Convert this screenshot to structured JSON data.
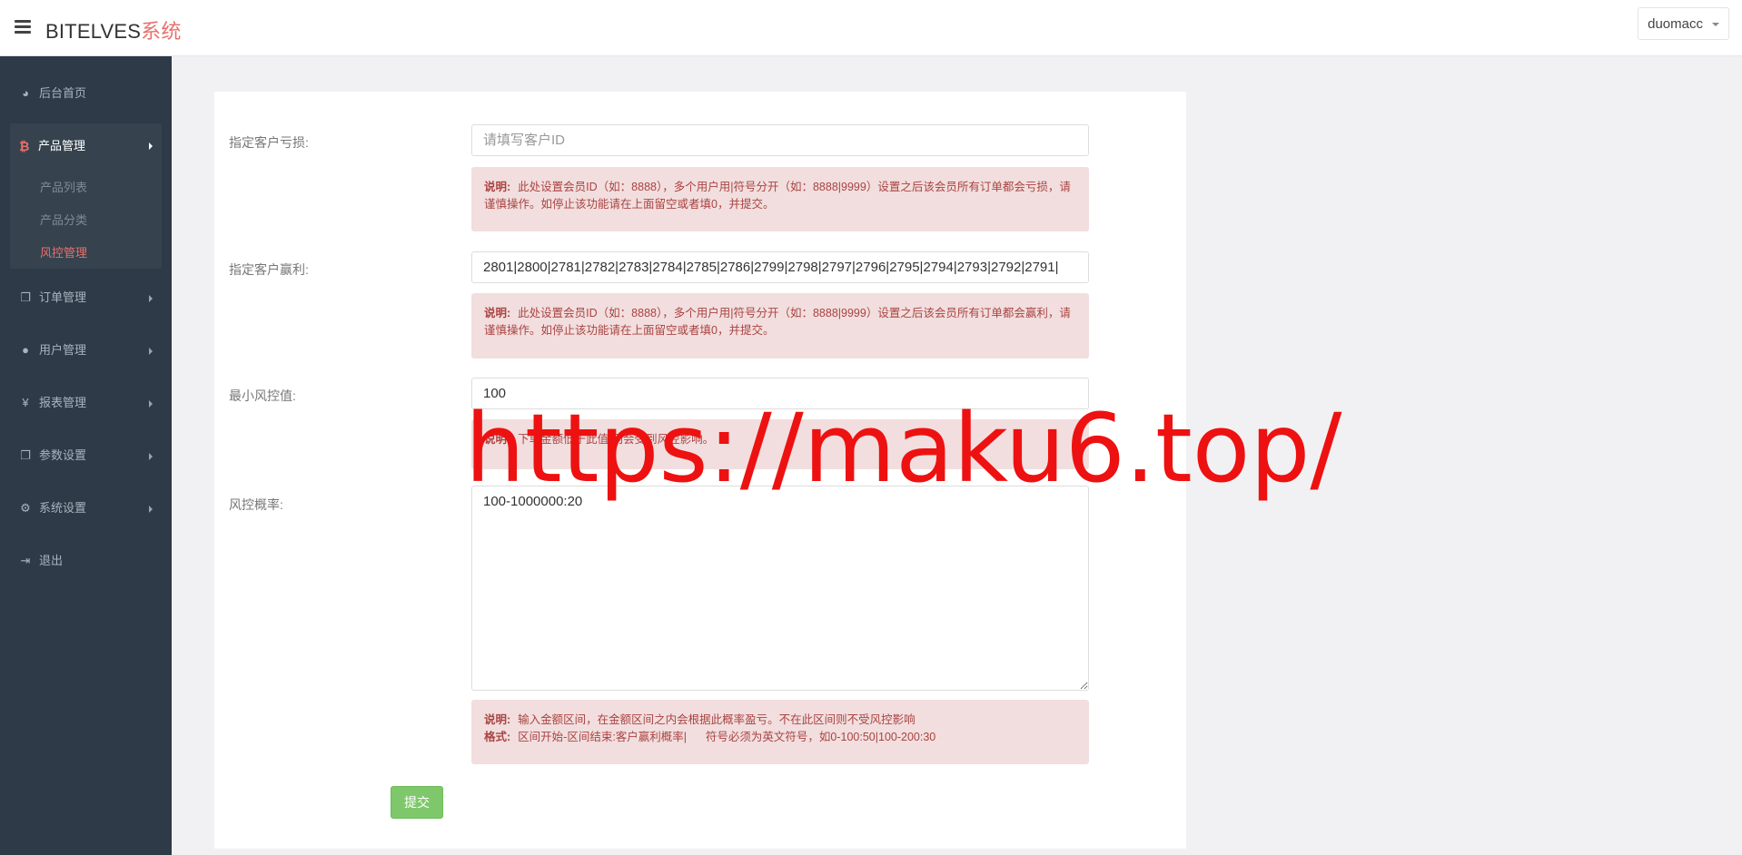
{
  "header": {
    "brand_main": "BITELVES",
    "brand_accent": "系统",
    "user_name": "duomacc"
  },
  "sidebar": {
    "items": [
      {
        "icon": "dashboard-icon",
        "label": "后台首页"
      },
      {
        "icon": "bitcoin-icon",
        "label": "产品管理"
      },
      {
        "icon": "copy-icon",
        "label": "订单管理"
      },
      {
        "icon": "user-icon",
        "label": "用户管理"
      },
      {
        "icon": "yen-icon",
        "label": "报表管理"
      },
      {
        "icon": "copy-icon",
        "label": "参数设置"
      },
      {
        "icon": "gears-icon",
        "label": "系统设置"
      },
      {
        "icon": "sign-out-icon",
        "label": "退出"
      }
    ],
    "sub_items": [
      {
        "label": "产品列表"
      },
      {
        "label": "产品分类"
      },
      {
        "label": "风控管理"
      }
    ],
    "active_color": "#e8706a"
  },
  "form": {
    "loss_label": "指定客户亏损:",
    "loss_placeholder": "请填写客户ID",
    "loss_value": "",
    "loss_note_title": "说明:",
    "loss_note_text": "此处设置会员ID（如：8888），多个用户用|符号分开（如：8888|9999）设置之后该会员所有订单都会亏损，请谨慎操作。如停止该功能请在上面留空或者填0，并提交。",
    "win_label": "指定客户赢利:",
    "win_value": "2801|2800|2781|2782|2783|2784|2785|2786|2799|2798|2797|2796|2795|2794|2793|2792|2791|",
    "win_note_title": "说明:",
    "win_note_text": "此处设置会员ID（如：8888），多个用户用|符号分开（如：8888|9999）设置之后该会员所有订单都会赢利，请谨慎操作。如停止该功能请在上面留空或者填0，并提交。",
    "min_label": "最小风控值:",
    "min_value": "100",
    "min_note_title": "说明:",
    "min_note_text": "下单金额低于此值,则会受到风控影响。",
    "rate_label": "风控概率:",
    "rate_value": "100-1000000:20",
    "rate_note_title": "说明:",
    "rate_note_text": "输入金额区间，在金额区间之内会根据此概率盈亏。不在此区间则不受风控影响",
    "rate_format_title": "格式:",
    "rate_format_text": "区间开始-区间结束:客户赢利概率|      符号必须为英文符号，如0-100:50|100-200:30",
    "submit_label": "提交"
  },
  "watermark": {
    "text": "https://maku6.top/",
    "color": "#ee1111"
  }
}
